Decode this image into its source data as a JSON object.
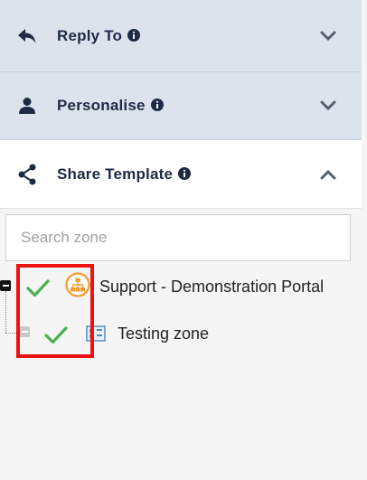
{
  "panels": {
    "reply_to": {
      "label": "Reply To",
      "icon": "reply-icon",
      "state": "collapsed"
    },
    "personalise": {
      "label": "Personalise",
      "icon": "person-icon",
      "state": "collapsed"
    },
    "share_template": {
      "label": "Share Template",
      "icon": "share-icon",
      "state": "expanded"
    }
  },
  "search": {
    "placeholder": "Search zone",
    "value": ""
  },
  "tree": {
    "nodes": [
      {
        "label": "Support - Demonstration Portal",
        "checked": true,
        "expanded": true,
        "icon": "org-chart-icon"
      },
      {
        "label": "Testing zone",
        "checked": true,
        "icon": "zone-icon"
      }
    ]
  },
  "colors": {
    "collapsed_panel_bg": "#dce3ed",
    "text_dark": "#1e2a44",
    "check_green": "#4caf50",
    "highlight_red": "#ee1111",
    "org_icon_orange": "#f39c32",
    "zone_icon_blue": "#5b8ec7"
  }
}
